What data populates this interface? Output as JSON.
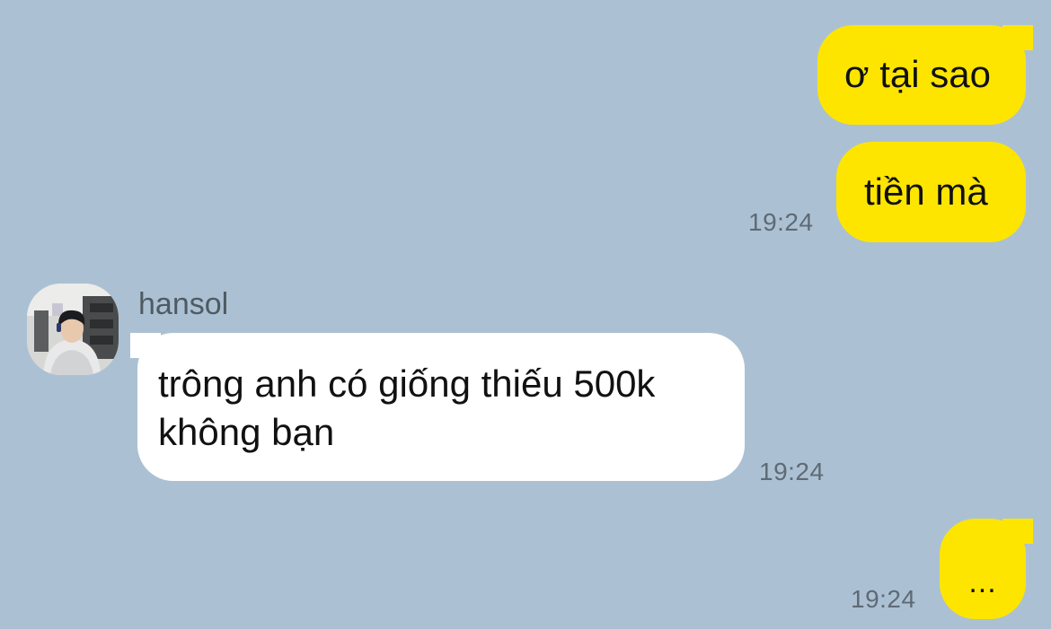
{
  "colors": {
    "background": "#abc1d3",
    "my_bubble": "#fee500",
    "their_bubble": "#ffffff",
    "timestamp": "#5e6a75"
  },
  "messages": [
    {
      "from": "me",
      "text": "ơ tại sao"
    },
    {
      "from": "me",
      "text": "tiền mà",
      "time": "19:24"
    },
    {
      "from": "hansol",
      "sender": "hansol",
      "text": "trông anh có giống thiếu 500k không bạn",
      "time": "19:24"
    },
    {
      "from": "me",
      "text": "...",
      "time": "19:24"
    }
  ],
  "contact": {
    "name": "hansol",
    "avatar_icon": "profile-photo-icon"
  }
}
